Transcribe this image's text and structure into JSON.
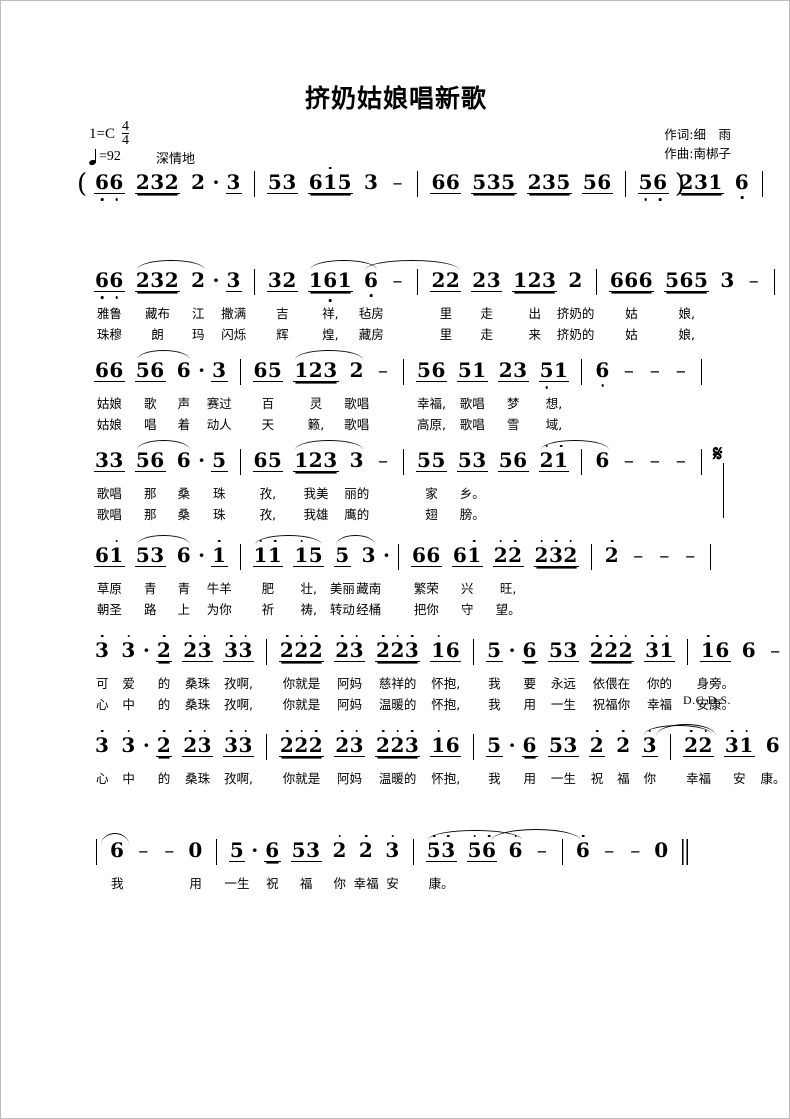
{
  "sheet": {
    "title": "挤奶姑娘唱新歌",
    "key_label": "1=C",
    "time_sig_num": "4",
    "time_sig_den": "4",
    "tempo_label": "=92",
    "expression": "深情地",
    "lyricist": "作词:细　雨",
    "composer": "作曲:南梆子",
    "repeat_mark": "D.C.D.S.",
    "segno": "𝄋"
  },
  "lines": [
    {
      "id": "intro",
      "measures": [
        {
          "groups": [
            {
              "text": "66",
              "beam": 1,
              "octave": [
                "lo",
                "lo"
              ]
            },
            {
              "text": "232",
              "beam": 2
            },
            {
              "text": "2",
              "beam": 0,
              "dotted": true
            },
            {
              "text": "3",
              "beam": 1
            }
          ]
        },
        {
          "groups": [
            {
              "text": "53",
              "beam": 1
            },
            {
              "text": "615",
              "beam": 2,
              "octave": [
                "",
                "hi",
                ""
              ]
            },
            {
              "text": "3",
              "beam": 0
            },
            {
              "dash": true
            }
          ]
        },
        {
          "groups": [
            {
              "text": "66",
              "beam": 1
            },
            {
              "text": "535",
              "beam": 2
            },
            {
              "text": "235",
              "beam": 2
            },
            {
              "text": "56",
              "beam": 1
            }
          ]
        },
        {
          "groups": [
            {
              "text": "56",
              "beam": 1,
              "octave": [
                "lo",
                "lo"
              ]
            },
            {
              "text": "231",
              "beam": 2
            },
            {
              "text": "6",
              "beam": 0,
              "octave": [
                "lo"
              ]
            }
          ]
        }
      ],
      "lyrics1": [],
      "lyrics2": []
    },
    {
      "id": "verse-a1",
      "measures": [
        {
          "groups": [
            {
              "text": "66",
              "beam": 1,
              "octave": [
                "lo",
                "lo"
              ]
            },
            {
              "text": "232",
              "beam": 2
            },
            {
              "text": "2",
              "beam": 0,
              "dotted": true
            },
            {
              "text": "3",
              "beam": 1
            }
          ]
        },
        {
          "groups": [
            {
              "text": "32",
              "beam": 1
            },
            {
              "text": "161",
              "beam": 2,
              "octave": [
                "",
                "lo",
                ""
              ]
            },
            {
              "text": "6",
              "beam": 0,
              "octave": [
                "lo"
              ]
            },
            {
              "dash": true
            }
          ]
        },
        {
          "groups": [
            {
              "text": "22",
              "beam": 1
            },
            {
              "text": "23",
              "beam": 1
            },
            {
              "text": "123",
              "beam": 2
            },
            {
              "text": "2",
              "beam": 0
            }
          ]
        },
        {
          "groups": [
            {
              "text": "666",
              "beam": 2
            },
            {
              "text": "565",
              "beam": 2
            },
            {
              "text": "3",
              "beam": 0
            },
            {
              "dash": true
            }
          ]
        }
      ],
      "lyrics1": [
        "雅鲁",
        "藏布",
        "江",
        "撒满",
        "吉",
        "祥,",
        "毡房",
        "里",
        "走",
        "出",
        "挤奶的",
        "姑",
        "娘,"
      ],
      "lyrics2": [
        "珠穆",
        "朗",
        "玛",
        "闪烁",
        "辉",
        "煌,",
        "藏房",
        "里",
        "走",
        "来",
        "挤奶的",
        "姑",
        "娘,"
      ]
    },
    {
      "id": "verse-a2",
      "measures": [
        {
          "groups": [
            {
              "text": "66",
              "beam": 1
            },
            {
              "text": "56",
              "beam": 1
            },
            {
              "text": "6",
              "beam": 0,
              "dotted": true
            },
            {
              "text": "3",
              "beam": 1
            }
          ]
        },
        {
          "groups": [
            {
              "text": "65",
              "beam": 1
            },
            {
              "text": "123",
              "beam": 2
            },
            {
              "text": "2",
              "beam": 0
            },
            {
              "dash": true
            }
          ]
        },
        {
          "groups": [
            {
              "text": "56",
              "beam": 1
            },
            {
              "text": "51",
              "beam": 1
            },
            {
              "text": "23",
              "beam": 1
            },
            {
              "text": "51",
              "beam": 1,
              "octave": [
                "lo",
                ""
              ]
            }
          ]
        },
        {
          "groups": [
            {
              "text": "6",
              "beam": 0,
              "octave": [
                "lo"
              ]
            },
            {
              "dash": true
            },
            {
              "dash": true
            },
            {
              "dash": true
            }
          ]
        }
      ],
      "lyrics1": [
        "姑娘",
        "歌",
        "声",
        "赛过",
        "百",
        "灵",
        "歌唱",
        "幸福,",
        "歌唱",
        "梦",
        "想,"
      ],
      "lyrics2": [
        "姑娘",
        "唱",
        "着",
        "动人",
        "天",
        "籁,",
        "歌唱",
        "高原,",
        "歌唱",
        "雪",
        "域,"
      ]
    },
    {
      "id": "verse-a3",
      "measures": [
        {
          "groups": [
            {
              "text": "33",
              "beam": 1
            },
            {
              "text": "56",
              "beam": 1
            },
            {
              "text": "6",
              "beam": 0,
              "dotted": true
            },
            {
              "text": "5",
              "beam": 1
            }
          ]
        },
        {
          "groups": [
            {
              "text": "65",
              "beam": 1
            },
            {
              "text": "123",
              "beam": 2
            },
            {
              "text": "3",
              "beam": 0
            },
            {
              "dash": true
            }
          ]
        },
        {
          "groups": [
            {
              "text": "55",
              "beam": 1
            },
            {
              "text": "53",
              "beam": 1
            },
            {
              "text": "56",
              "beam": 1
            },
            {
              "text": "21",
              "beam": 1,
              "octave": [
                "hi",
                "hi"
              ]
            }
          ]
        },
        {
          "groups": [
            {
              "text": "6",
              "beam": 0
            },
            {
              "dash": true
            },
            {
              "dash": true
            },
            {
              "dash": true
            }
          ]
        }
      ],
      "lyrics1": [
        "歌唱",
        "那",
        "桑",
        "珠",
        "孜,",
        "我美",
        "丽的",
        "家",
        "乡。"
      ],
      "lyrics2": [
        "歌唱",
        "那",
        "桑",
        "珠",
        "孜,",
        "我雄",
        "鹰的",
        "翅",
        "膀。"
      ]
    },
    {
      "id": "verse-a4",
      "measures": [
        {
          "groups": [
            {
              "text": "61",
              "beam": 1,
              "octave": [
                "",
                "hi"
              ]
            },
            {
              "text": "53",
              "beam": 1
            },
            {
              "text": "6",
              "beam": 0,
              "dotted": true
            },
            {
              "text": "1",
              "beam": 1,
              "octave": [
                "hi"
              ]
            }
          ]
        },
        {
          "groups": [
            {
              "text": "11",
              "beam": 1,
              "octave": [
                "hi",
                "hi"
              ]
            },
            {
              "text": "15",
              "beam": 1,
              "octave": [
                "hi",
                ""
              ]
            },
            {
              "text": "5",
              "beam": 1
            },
            {
              "text": "3",
              "beam": 0,
              "dotted": true
            }
          ]
        },
        {
          "groups": [
            {
              "text": "66",
              "beam": 1
            },
            {
              "text": "61",
              "beam": 1,
              "octave": [
                "",
                "hi"
              ]
            },
            {
              "text": "22",
              "beam": 1,
              "octave": [
                "hi",
                "hi"
              ]
            },
            {
              "text": "232",
              "beam": 2,
              "octave": [
                "hi",
                "hi",
                "hi"
              ]
            }
          ]
        },
        {
          "groups": [
            {
              "text": "2",
              "beam": 0,
              "octave": [
                "hi"
              ]
            },
            {
              "dash": true
            },
            {
              "dash": true
            },
            {
              "dash": true
            }
          ]
        }
      ],
      "lyrics1": [
        "草原",
        "青",
        "青",
        "牛羊",
        "肥",
        "壮,",
        "美丽",
        "藏南",
        "繁荣",
        "兴",
        "旺,"
      ],
      "lyrics2": [
        "朝圣",
        "路",
        "上",
        "为你",
        "祈",
        "祷,",
        "转动",
        "经桶",
        "把你",
        "守",
        "望。"
      ]
    },
    {
      "id": "chorus-1",
      "measures": [
        {
          "groups": [
            {
              "text": "3",
              "beam": 0,
              "octave": [
                "hi"
              ]
            },
            {
              "text": "3",
              "beam": 0,
              "dotted": true,
              "octave": [
                "hi"
              ]
            },
            {
              "text": "2",
              "beam": 2,
              "octave": [
                "hi"
              ]
            },
            {
              "text": "23",
              "beam": 1,
              "octave": [
                "hi",
                "hi"
              ]
            },
            {
              "text": "33",
              "beam": 1,
              "octave": [
                "hi",
                "hi"
              ]
            }
          ]
        },
        {
          "groups": [
            {
              "text": "222",
              "beam": 2,
              "octave": [
                "hi",
                "hi",
                "hi"
              ]
            },
            {
              "text": "23",
              "beam": 1,
              "octave": [
                "hi",
                "hi"
              ]
            },
            {
              "text": "223",
              "beam": 2,
              "octave": [
                "hi",
                "hi",
                "hi"
              ]
            },
            {
              "text": "16",
              "beam": 1,
              "octave": [
                "hi",
                ""
              ]
            }
          ]
        },
        {
          "groups": [
            {
              "text": "5",
              "beam": 1,
              "dotted": true
            },
            {
              "text": "6",
              "beam": 2
            },
            {
              "text": "53",
              "beam": 1
            },
            {
              "text": "222",
              "beam": 2,
              "octave": [
                "hi",
                "hi",
                "hi"
              ]
            },
            {
              "text": "31",
              "beam": 1,
              "octave": [
                "hi",
                "hi"
              ]
            }
          ]
        },
        {
          "groups": [
            {
              "text": "16",
              "beam": 1,
              "octave": [
                "hi",
                ""
              ]
            },
            {
              "text": "6",
              "beam": 0
            },
            {
              "dash": true
            },
            {
              "dash": true
            }
          ]
        }
      ],
      "lyrics1": [
        "可",
        "爱",
        "的",
        "桑珠",
        "孜啊,",
        "你就是",
        "阿妈",
        "慈祥的",
        "怀抱,",
        "我",
        "要",
        "永远",
        "依偎在",
        "你的",
        "身旁。"
      ],
      "lyrics2": [
        "心",
        "中",
        "的",
        "桑珠",
        "孜啊,",
        "你就是",
        "阿妈",
        "温暖的",
        "怀抱,",
        "我",
        "用",
        "一生",
        "祝福你",
        "幸福",
        "安康。"
      ]
    },
    {
      "id": "chorus-2",
      "measures": [
        {
          "groups": [
            {
              "text": "3",
              "beam": 0,
              "octave": [
                "hi"
              ]
            },
            {
              "text": "3",
              "beam": 0,
              "dotted": true,
              "octave": [
                "hi"
              ]
            },
            {
              "text": "2",
              "beam": 2,
              "octave": [
                "hi"
              ]
            },
            {
              "text": "23",
              "beam": 1,
              "octave": [
                "hi",
                "hi"
              ]
            },
            {
              "text": "33",
              "beam": 1,
              "octave": [
                "hi",
                "hi"
              ]
            }
          ]
        },
        {
          "groups": [
            {
              "text": "222",
              "beam": 2,
              "octave": [
                "hi",
                "hi",
                "hi"
              ]
            },
            {
              "text": "23",
              "beam": 1,
              "octave": [
                "hi",
                "hi"
              ]
            },
            {
              "text": "223",
              "beam": 2,
              "octave": [
                "hi",
                "hi",
                "hi"
              ]
            },
            {
              "text": "16",
              "beam": 1,
              "octave": [
                "hi",
                ""
              ]
            }
          ]
        },
        {
          "groups": [
            {
              "text": "5",
              "beam": 1,
              "dotted": true
            },
            {
              "text": "6",
              "beam": 2
            },
            {
              "text": "53",
              "beam": 1
            },
            {
              "text": "2",
              "beam": 1,
              "octave": [
                "hi"
              ]
            },
            {
              "text": "2",
              "beam": 0,
              "octave": [
                "hi"
              ]
            },
            {
              "text": "3",
              "beam": 1,
              "octave": [
                "hi"
              ]
            }
          ]
        },
        {
          "groups": [
            {
              "text": "22",
              "beam": 1,
              "octave": [
                "hi",
                "hi"
              ]
            },
            {
              "text": "31",
              "beam": 1,
              "octave": [
                "hi",
                "hi"
              ]
            },
            {
              "text": "6",
              "beam": 0
            },
            {
              "dash": true
            }
          ]
        }
      ],
      "lyrics1": [
        "心",
        "中",
        "的",
        "桑珠",
        "孜啊,",
        "你就是",
        "阿妈",
        "温暖的",
        "怀抱,",
        "我",
        "用",
        "一生",
        "祝",
        "福",
        "你",
        "幸福",
        "安",
        "康。"
      ],
      "lyrics2": []
    },
    {
      "id": "ending",
      "measures": [
        {
          "groups": [
            {
              "text": "6",
              "beam": 0
            },
            {
              "dash": true
            },
            {
              "dash": true
            },
            {
              "text": "0",
              "beam": 0
            }
          ]
        },
        {
          "groups": [
            {
              "text": "5",
              "beam": 1,
              "dotted": true
            },
            {
              "text": "6",
              "beam": 2
            },
            {
              "text": "53",
              "beam": 1
            },
            {
              "text": "2",
              "beam": 0,
              "octave": [
                "hi"
              ]
            },
            {
              "text": "2",
              "beam": 0,
              "octave": [
                "hi"
              ]
            },
            {
              "text": "3",
              "beam": 0,
              "octave": [
                "hi"
              ]
            }
          ]
        },
        {
          "groups": [
            {
              "text": "53",
              "beam": 1,
              "octave": [
                "hi",
                "hi"
              ]
            },
            {
              "text": "56",
              "beam": 1,
              "octave": [
                "hi",
                "hi"
              ]
            },
            {
              "text": "6",
              "beam": 0,
              "octave": [
                "hi"
              ]
            },
            {
              "dash": true
            }
          ]
        },
        {
          "groups": [
            {
              "text": "6",
              "beam": 0,
              "octave": [
                "hi"
              ]
            },
            {
              "dash": true
            },
            {
              "dash": true
            },
            {
              "text": "0",
              "beam": 0
            }
          ]
        }
      ],
      "lyrics1": [
        "我",
        "用",
        "一生",
        "祝",
        "福",
        "你",
        "幸福",
        "安",
        "康。"
      ],
      "lyrics2": []
    }
  ]
}
